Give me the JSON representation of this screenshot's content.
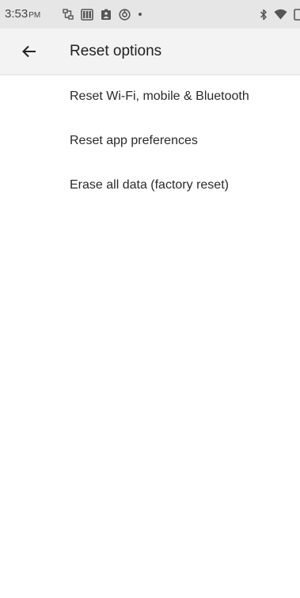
{
  "status_bar": {
    "time": "3:53",
    "ampm": "PM",
    "left_icons": [
      "network-icon",
      "keyboard-icon",
      "assignment-icon",
      "sync-icon",
      "dot-icon"
    ],
    "right_icons": [
      "bluetooth-icon",
      "wifi-icon",
      "battery-icon"
    ]
  },
  "app_bar": {
    "back_icon": "arrow-left-icon",
    "title": "Reset options"
  },
  "options": [
    {
      "label": "Reset Wi-Fi, mobile & Bluetooth"
    },
    {
      "label": "Reset app preferences"
    },
    {
      "label": "Erase all data (factory reset)"
    }
  ],
  "colors": {
    "status_bar_bg": "#e6e6e6",
    "app_bar_bg": "#f3f3f3",
    "background": "#ffffff",
    "text": "#222222"
  }
}
